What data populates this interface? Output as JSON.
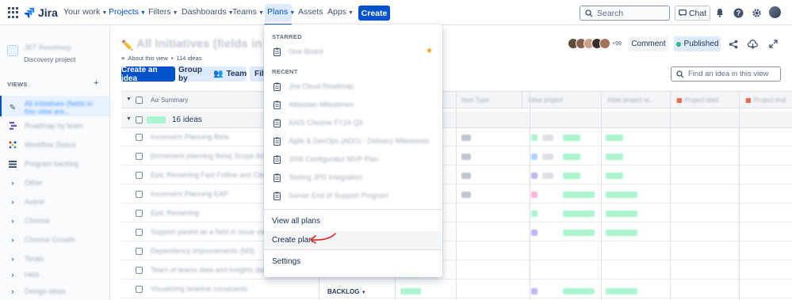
{
  "topnav": {
    "logo_text": "Jira",
    "items": [
      {
        "label": "Your work",
        "active": false
      },
      {
        "label": "Projects",
        "active": true
      },
      {
        "label": "Filters",
        "active": false
      },
      {
        "label": "Dashboards",
        "active": false
      },
      {
        "label": "Teams",
        "active": false
      },
      {
        "label": "Plans",
        "active": true
      },
      {
        "label": "Assets",
        "active": false
      },
      {
        "label": "Apps",
        "active": false
      }
    ],
    "create_label": "Create",
    "search_placeholder": "Search",
    "chat_label": "Chat",
    "brand_color": "#0052cc"
  },
  "sidebar": {
    "project_name": "JET Roadmap",
    "project_type": "Discovery project",
    "views_label": "VIEWS",
    "items": [
      {
        "label": "All Initiatives (fields in this view are...",
        "icon": "initiatives-icon",
        "active": true
      },
      {
        "label": "Roadmap by team",
        "icon": "roadmap-icon"
      },
      {
        "label": "Workflow Status",
        "icon": "workflow-icon"
      },
      {
        "label": "Program backlog",
        "icon": "list-icon"
      },
      {
        "label": "Other",
        "icon": "chevron-right-icon"
      },
      {
        "label": "Avenir",
        "icon": "chevron-right-icon"
      },
      {
        "label": "Chrome",
        "icon": "chevron-right-icon"
      },
      {
        "label": "Chrome Growth",
        "icon": "chevron-right-icon"
      },
      {
        "label": "Teralo",
        "icon": "chevron-right-icon"
      },
      {
        "label": "Helo",
        "icon": "chevron-right-icon"
      },
      {
        "label": "Design ideas",
        "icon": "chevron-right-icon"
      }
    ]
  },
  "main": {
    "title": "All Initiatives (fields in this view",
    "about_label": "About this view",
    "ideas_count": "114 ideas",
    "create_idea_label": "Create an idea",
    "group_by_label": "Group by",
    "group_by_value": "Team",
    "filter_label": "Filt",
    "avatar_extra": "+99",
    "comment_label": "Comment",
    "published_label": "Published",
    "find_placeholder": "Find an idea in this view",
    "columns": {
      "summary": "Summary",
      "item_type": "Item Type",
      "atlas_project": "Atlas project",
      "atlas_project_status": "Atlas project st...",
      "project_start": "Project start",
      "project_end": "Project end"
    },
    "group_count": "16 ideas",
    "rows": [
      "Increment Planning Beta",
      "[Increment planning Beta] Scope limits",
      "Epic Renaming Fast Follow and Clean-up",
      "Increment Planning EAP",
      "Epic Renaming",
      "Support parent as a field in issue view",
      "Dependency Improvements (M3)",
      "Team of teams data and insights dashboard",
      "Visualizing timeline constraints"
    ],
    "backlog_label": "BACKLOG"
  },
  "dropdown": {
    "starred_label": "STARRED",
    "starred": [
      {
        "label": "One Board"
      }
    ],
    "recent_label": "RECENT",
    "recent": [
      {
        "label": "Jira Cloud Roadmap"
      },
      {
        "label": "Atlassian Milestones"
      },
      {
        "label": "AAIS Chrome FY24 Q3"
      },
      {
        "label": "Agile & DevOps (ADO) - Delivery Milestones"
      },
      {
        "label": "JSW Configurator MVP Plan"
      },
      {
        "label": "Testing JPD Integration"
      },
      {
        "label": "Server End of Support Program"
      }
    ],
    "view_all_label": "View all plans",
    "create_plan_label": "Create plan",
    "settings_label": "Settings"
  }
}
